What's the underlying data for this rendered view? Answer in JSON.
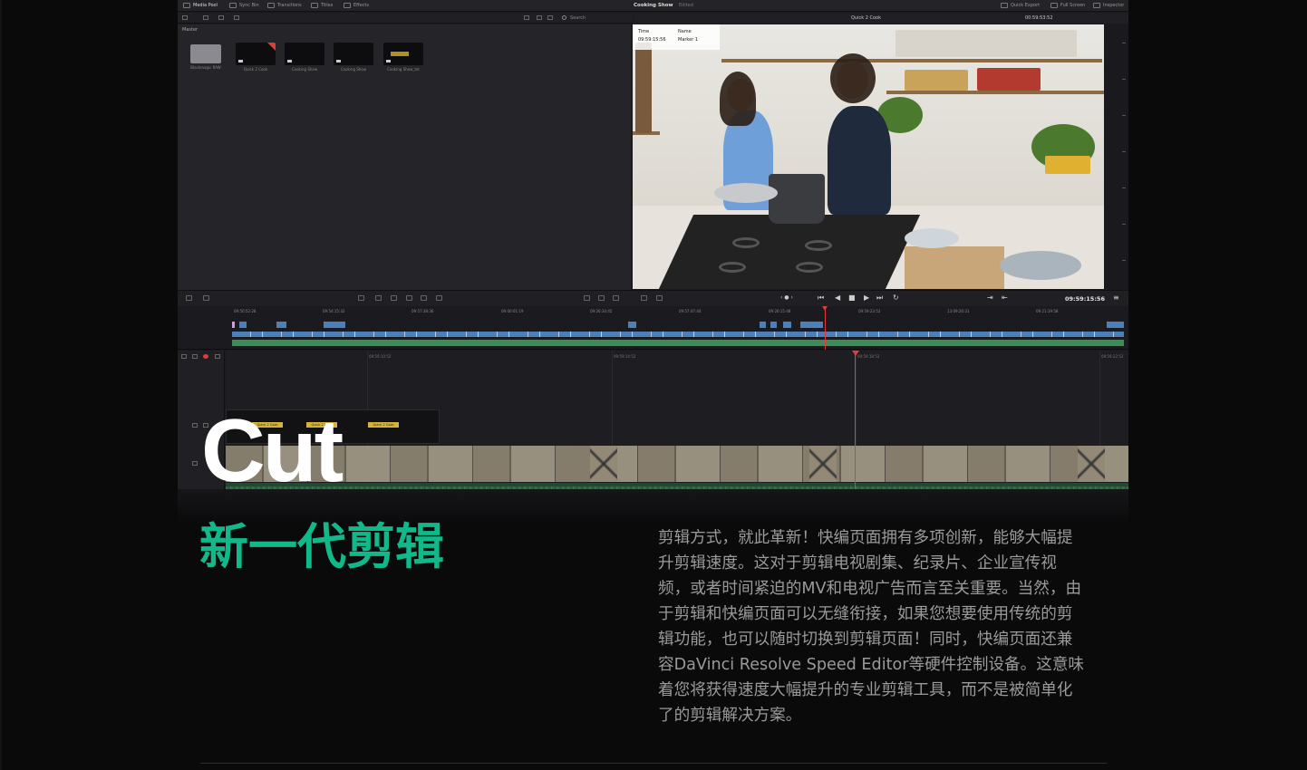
{
  "app": {
    "top_tabs": [
      "Media Pool",
      "Sync Bin",
      "Transitions",
      "Titles",
      "Effects"
    ],
    "viewer_title": "Cooking Show",
    "viewer_edited": "Edited",
    "right_tabs": [
      "Quick Export",
      "Full Screen",
      "Inspector"
    ],
    "search_label": "Search",
    "master_label": "Master",
    "clips": [
      {
        "name": "Blackmagic RAW",
        "kind": "folder"
      },
      {
        "name": "Quick 2 Cook",
        "kind": "timeline"
      },
      {
        "name": "Cooking Show",
        "kind": "timeline"
      },
      {
        "name": "Cooking Show",
        "kind": "timeline"
      },
      {
        "name": "Cooking Show_txt",
        "kind": "title"
      }
    ],
    "viewer_top": {
      "clip_name": "Quick 2 Cook",
      "timecode": "00:59:53:52"
    },
    "overlay": {
      "time_label": "Time",
      "time_value": "09:59:15:56",
      "name_label": "Name",
      "name_value": "Marker 1"
    },
    "transport_timecode": "09:59:15:56",
    "upper_ruler": [
      "09:50:52:28",
      "09:54:15:32",
      "09:57:38:36",
      "09:00:01:19",
      "09:26:34:45",
      "09:57:47:44",
      "09:26:15:48",
      "09:59:23:52",
      "13:09:26:31",
      "09:21:19:58"
    ],
    "lower_ruler": [
      "09:59:10:52",
      "09:59:14:52",
      "09:59:18:52",
      "09:59:22:52"
    ],
    "title_clips": [
      "Quick 2 Cook",
      "Quick 2 Cook",
      "Quick 2 Cook"
    ]
  },
  "hero": {
    "title": "Cut",
    "subtitle": "新一代剪辑",
    "description": "剪辑方式，就此革新！快编页面拥有多项创新，能够大幅提升剪辑速度。这对于剪辑电视剧集、纪录片、企业宣传视频，或者时间紧迫的MV和电视广告而言至关重要。当然，由于剪辑和快编页面可以无缝衔接，如果您想要使用传统的剪辑功能，也可以随时切换到剪辑页面！同时，快编页面还兼容DaVinci Resolve Speed Editor等硬件控制设备。这意味着您将获得速度大幅提升的专业剪辑工具，而不是被简单化了的剪辑解决方案。"
  },
  "colors": {
    "accent": "#11b98a",
    "background": "#0a0a0b",
    "playhead": "#e23b3b",
    "video_track": "#4d7fb8",
    "audio_track": "#3c8c56"
  }
}
